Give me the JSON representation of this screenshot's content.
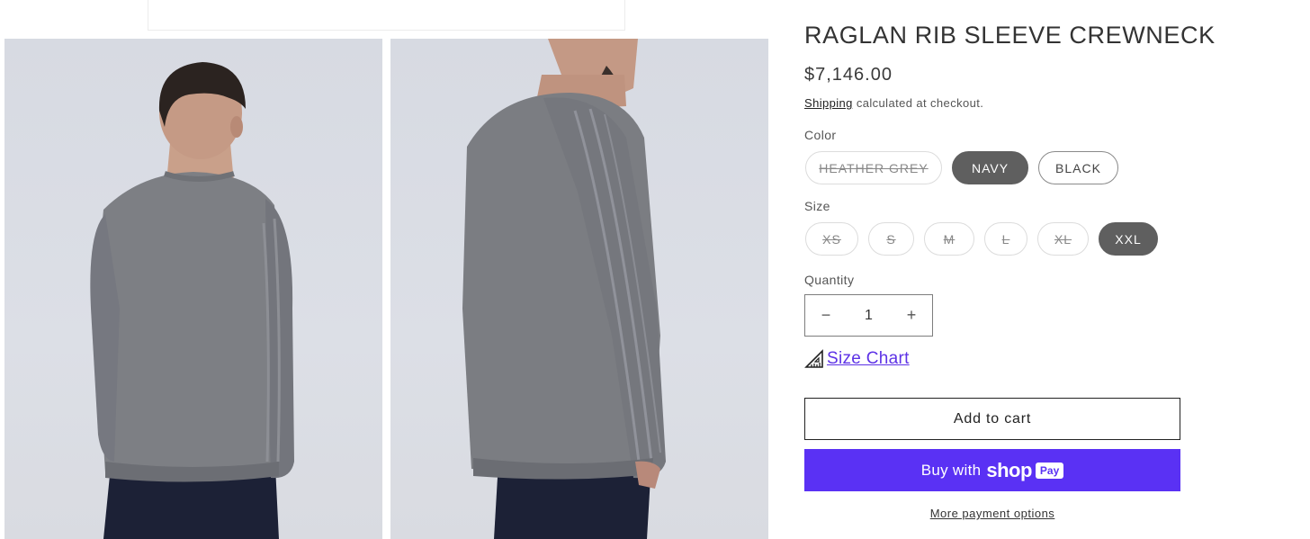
{
  "product": {
    "title": "RAGLAN RIB SLEEVE CREWNECK",
    "price": "$7,146.00",
    "shipping_link": "Shipping",
    "shipping_suffix": " calculated at checkout."
  },
  "images": [
    {
      "name": "product-image-back",
      "description": "sweater-back-view"
    },
    {
      "name": "product-image-side",
      "description": "sweater-side-view"
    }
  ],
  "color": {
    "label": "Color",
    "options": [
      {
        "label": "HEATHER GREY",
        "state": "unavailable"
      },
      {
        "label": "NAVY",
        "state": "selected"
      },
      {
        "label": "BLACK",
        "state": "available"
      }
    ]
  },
  "size": {
    "label": "Size",
    "options": [
      {
        "label": "XS",
        "state": "unavailable"
      },
      {
        "label": "S",
        "state": "unavailable"
      },
      {
        "label": "M",
        "state": "unavailable"
      },
      {
        "label": "L",
        "state": "unavailable"
      },
      {
        "label": "XL",
        "state": "unavailable"
      },
      {
        "label": "XXL",
        "state": "selected"
      }
    ]
  },
  "quantity": {
    "label": "Quantity",
    "value": "1",
    "decrease_icon": "−",
    "increase_icon": "+"
  },
  "size_chart": {
    "icon": "ruler-icon",
    "label": "Size Chart"
  },
  "buttons": {
    "add_to_cart": "Add to cart",
    "buy_with": "Buy with",
    "shop_word": "shop",
    "pay_badge": "Pay",
    "more_payment": "More payment options"
  },
  "colors": {
    "accent": "#5a31f4",
    "link": "#5d32e6",
    "selected_pill": "#5f5f5f",
    "sweater": "#7d7f84",
    "pants": "#1c2136",
    "background_photo": "#d9dce3"
  }
}
